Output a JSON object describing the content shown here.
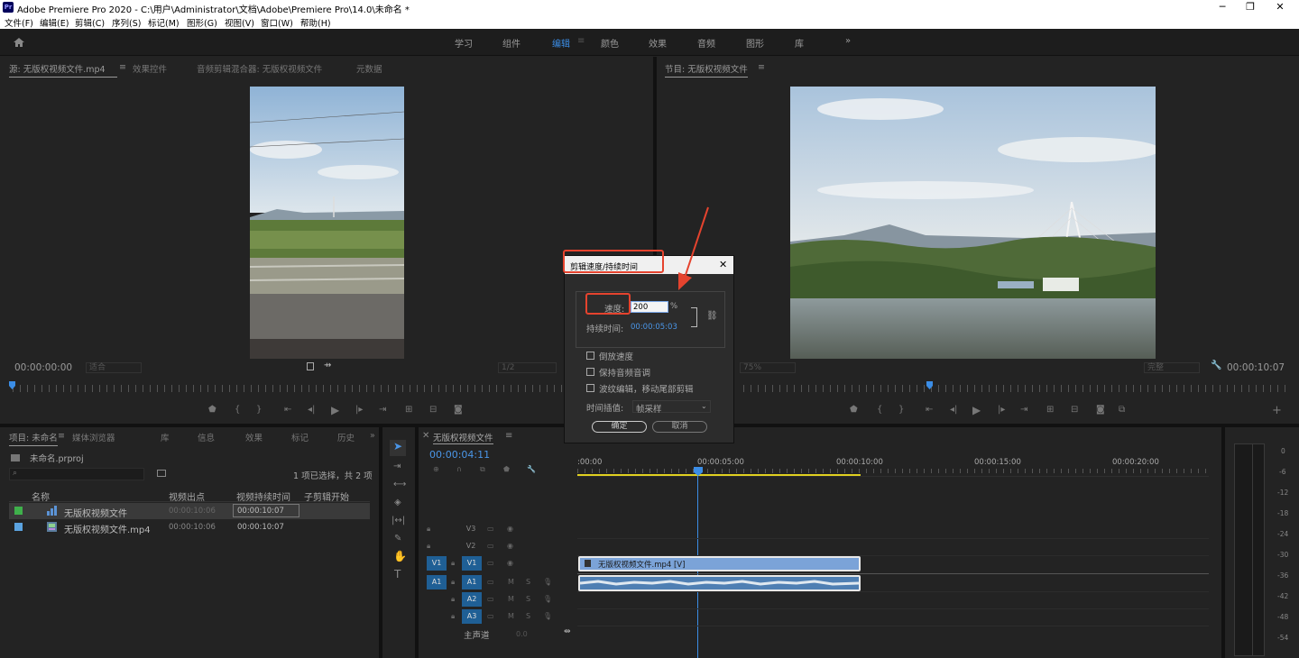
{
  "window": {
    "app_icon": "Pr",
    "title": "Adobe Premiere Pro 2020 - C:\\用户\\Administrator\\文档\\Adobe\\Premiere Pro\\14.0\\未命名 *",
    "minimize": "─",
    "maximize": "❐",
    "close": "✕"
  },
  "menu": [
    "文件(F)",
    "编辑(E)",
    "剪辑(C)",
    "序列(S)",
    "标记(M)",
    "图形(G)",
    "视图(V)",
    "窗口(W)",
    "帮助(H)"
  ],
  "workspaces": [
    "学习",
    "组件",
    "编辑",
    "颜色",
    "效果",
    "音频",
    "图形",
    "库"
  ],
  "workspace_active": "编辑",
  "workspace_more": "»",
  "source_panel": {
    "tabs": [
      "源: 无版权视频文件.mp4",
      "效果控件",
      "音频剪辑混合器: 无版权视频文件",
      "元数据"
    ],
    "timecode": "00:00:00:00",
    "fit": "适合",
    "quality": "1/2"
  },
  "program_panel": {
    "tab": "节目: 无版权视频文件",
    "zoom": "75%",
    "quality": "完整",
    "timecode": "00:00:10:07"
  },
  "dialog": {
    "title": "剪辑速度/持续时间",
    "close": "✕",
    "speed_label": "速度:",
    "speed_value": "200",
    "percent": "%",
    "duration_label": "持续时间:",
    "duration_value": "00:00:05:03",
    "reverse": "倒放速度",
    "maintain_pitch": "保持音频音调",
    "ripple": "波纹编辑，移动尾部剪辑",
    "interp_label": "时间插值:",
    "interp_value": "帧采样",
    "ok": "确定",
    "cancel": "取消"
  },
  "project_panel": {
    "tabs": [
      "项目: 未命名",
      "媒体浏览器",
      "库",
      "信息",
      "效果",
      "标记",
      "历史"
    ],
    "more": "»",
    "project_file": "未命名.prproj",
    "selection_info": "1 项已选择，共 2 项",
    "columns": [
      "名称",
      "视频出点",
      "视频持续时间",
      "子剪辑开始"
    ],
    "items": [
      {
        "name": "无版权视频文件",
        "out": "00:00:10:06",
        "duration": "00:00:10:07",
        "color": "#3fb04b"
      },
      {
        "name": "无版权视频文件.mp4",
        "out": "00:00:10:06",
        "duration": "00:00:10:07",
        "color": "#5ba3e0"
      }
    ]
  },
  "timeline": {
    "tab": "无版权视频文件",
    "timecode": "00:00:04:11",
    "ruler_labels": [
      ":00:00",
      "00:00:05:00",
      "00:00:10:00",
      "00:00:15:00",
      "00:00:20:00"
    ],
    "video_tracks": [
      "V3",
      "V2",
      "V1"
    ],
    "audio_tracks": [
      "A1",
      "A2",
      "A3"
    ],
    "src_v": "V1",
    "src_a": "A1",
    "master_label": "主声道",
    "master_value": "0.0",
    "video_clip": "无版权视频文件.mp4 [V]"
  },
  "tools": [
    "selection",
    "track-select",
    "ripple",
    "razor",
    "slip",
    "pen",
    "hand",
    "type"
  ],
  "meter": {
    "ticks": [
      "0",
      "-6",
      "-12",
      "-18",
      "-24",
      "-30",
      "-36",
      "-42",
      "-48",
      "-54"
    ]
  }
}
